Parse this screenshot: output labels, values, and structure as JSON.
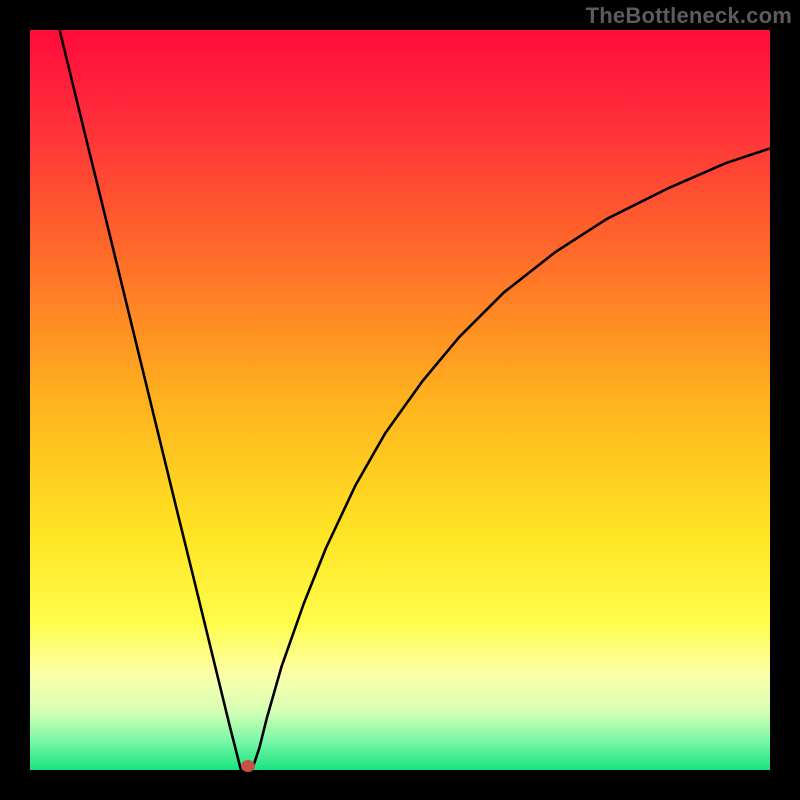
{
  "watermark": "TheBottleneck.com",
  "chart_data": {
    "type": "line",
    "title": "",
    "xlabel": "",
    "ylabel": "",
    "xlim": [
      0,
      100
    ],
    "ylim": [
      0,
      100
    ],
    "background_gradient_stops": [
      {
        "offset": 0.0,
        "color": "#ff0b3a"
      },
      {
        "offset": 0.12,
        "color": "#ff2d3a"
      },
      {
        "offset": 0.3,
        "color": "#ff6a2a"
      },
      {
        "offset": 0.5,
        "color": "#ffb21e"
      },
      {
        "offset": 0.68,
        "color": "#ffe423"
      },
      {
        "offset": 0.8,
        "color": "#fffc4a"
      },
      {
        "offset": 0.87,
        "color": "#fdffa8"
      },
      {
        "offset": 0.92,
        "color": "#d6ffb5"
      },
      {
        "offset": 0.96,
        "color": "#7cf8a8"
      },
      {
        "offset": 1.0,
        "color": "#18e380"
      }
    ],
    "series": [
      {
        "name": "bottleneck-curve",
        "x": [
          4,
          6,
          8,
          10,
          12,
          14,
          16,
          18,
          20,
          22,
          24,
          26,
          27,
          28,
          28.5,
          29,
          30,
          31,
          32,
          34,
          37,
          40,
          44,
          48,
          53,
          58,
          64,
          71,
          78,
          86,
          94,
          100
        ],
        "y": [
          100,
          91.8,
          83.6,
          75.5,
          67.3,
          59.1,
          50.9,
          42.7,
          34.5,
          26.4,
          18.2,
          10.0,
          5.9,
          2.0,
          0.0,
          0.0,
          0.0,
          3.0,
          7.0,
          14.0,
          22.5,
          30.0,
          38.5,
          45.5,
          52.5,
          58.5,
          64.5,
          70.0,
          74.5,
          78.5,
          82.0,
          84.0
        ]
      }
    ],
    "marker": {
      "x": 29.5,
      "y": 0.5,
      "color": "#c75048"
    }
  }
}
